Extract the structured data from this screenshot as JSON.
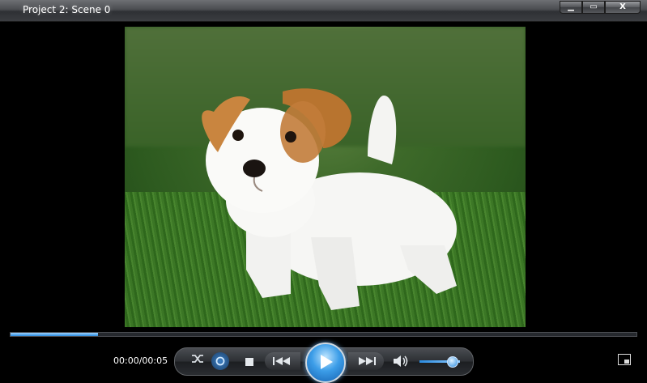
{
  "window": {
    "title": "Project 2: Scene 0",
    "min_glyph": "▁",
    "max_glyph": "▭",
    "close_glyph": "X"
  },
  "video": {
    "subject": "white puppy with brown ears on grass"
  },
  "playback": {
    "time_display": "00:00/00:05",
    "progress": 0.14
  },
  "controls": {
    "volume_level": 0.8
  },
  "colors": {
    "accent": "#2a8be0",
    "titlebar": "#3b3d41",
    "background": "#000000"
  },
  "icons": [
    "shuffle-icon",
    "repeat-icon",
    "stop-icon",
    "previous-icon",
    "play-icon",
    "next-icon",
    "speaker-icon",
    "switch-to-library-icon"
  ]
}
